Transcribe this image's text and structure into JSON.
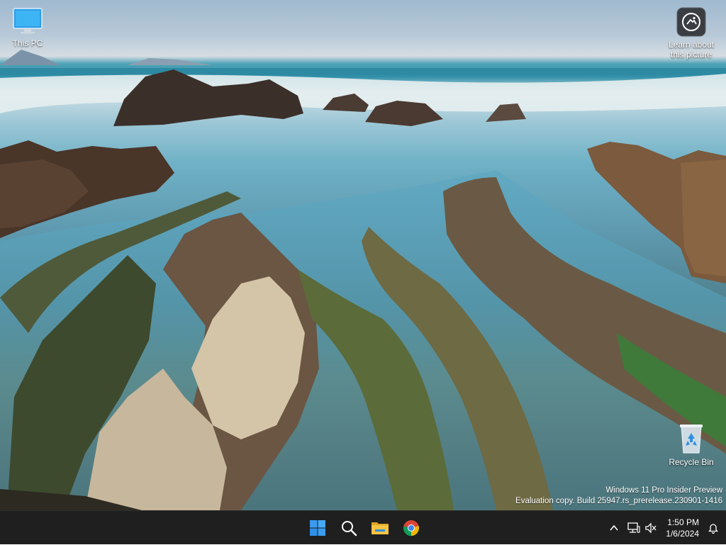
{
  "desktop": {
    "icons": [
      {
        "label": "This PC",
        "icon": "monitor-icon"
      },
      {
        "label": "Learn about\nthis picture",
        "icon": "camera-icon"
      },
      {
        "label": "Recycle Bin",
        "icon": "recycle-bin-icon"
      }
    ],
    "watermark": {
      "line1": "Windows 11 Pro Insider Preview",
      "line2": "Evaluation copy. Build 25947.rs_prerelease.230901-1416"
    }
  },
  "taskbar": {
    "pinned": [
      {
        "icon": "windows-start-icon"
      },
      {
        "icon": "search-icon"
      },
      {
        "icon": "file-explorer-icon"
      },
      {
        "icon": "chrome-icon"
      }
    ],
    "tray": {
      "icons": [
        "chevron-up-icon",
        "network-icon",
        "volume-muted-icon",
        "bell-icon"
      ],
      "time": "1:50 PM",
      "date": "1/6/2024"
    },
    "colors": {
      "background": "#1f1f1f",
      "start_blue": "#3a9bf0",
      "folder_yellow": "#f6c342"
    }
  }
}
